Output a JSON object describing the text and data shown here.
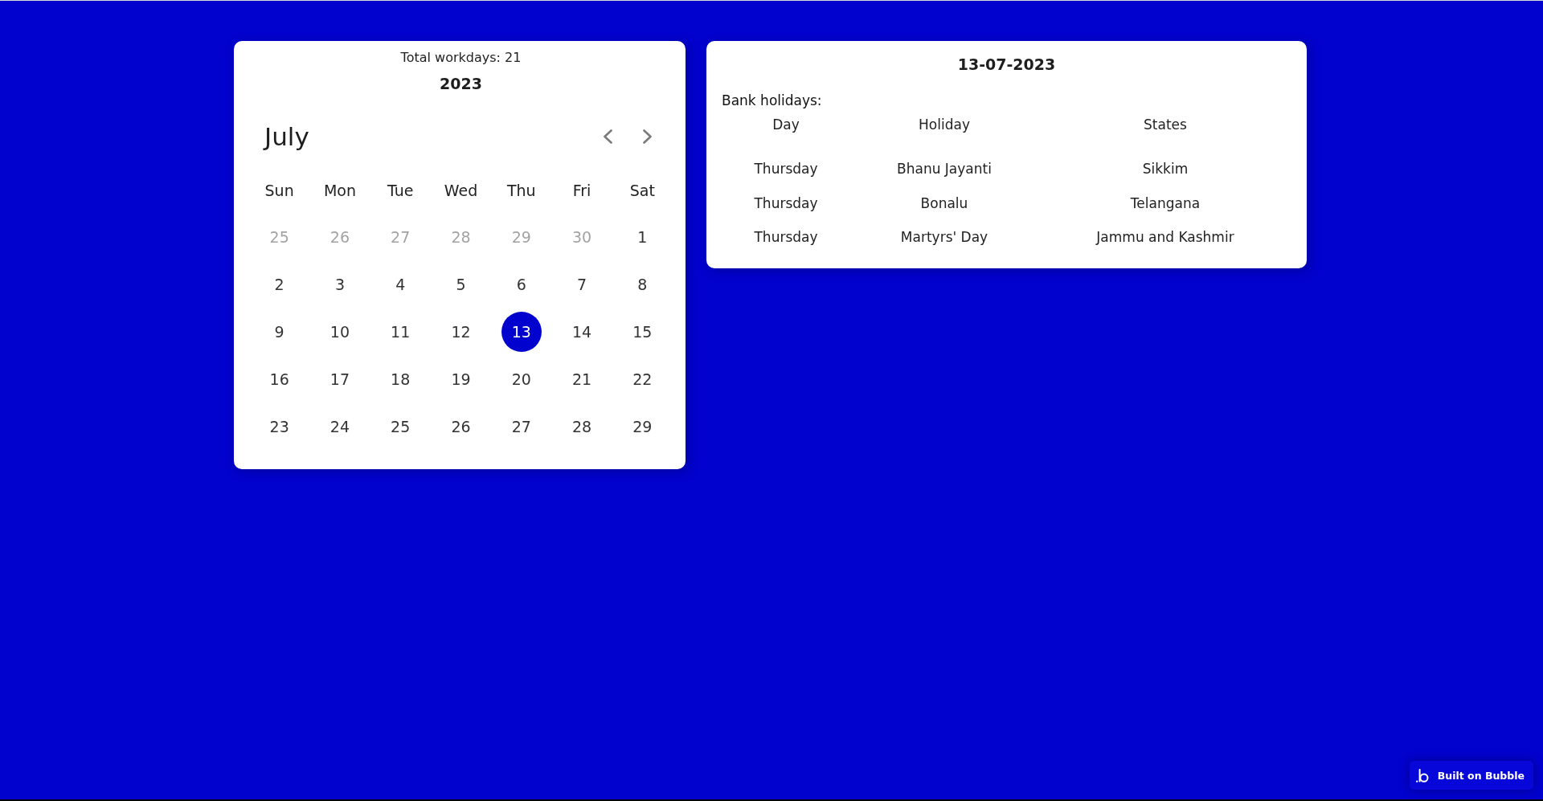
{
  "calendar": {
    "summary": "Total workdays: 21",
    "year": "2023",
    "month": "July",
    "weekdays": [
      "Sun",
      "Mon",
      "Tue",
      "Wed",
      "Thu",
      "Fri",
      "Sat"
    ],
    "days": [
      {
        "label": "25",
        "outside_month": true,
        "selected": false
      },
      {
        "label": "26",
        "outside_month": true,
        "selected": false
      },
      {
        "label": "27",
        "outside_month": true,
        "selected": false
      },
      {
        "label": "28",
        "outside_month": true,
        "selected": false
      },
      {
        "label": "29",
        "outside_month": true,
        "selected": false
      },
      {
        "label": "30",
        "outside_month": true,
        "selected": false
      },
      {
        "label": "1",
        "outside_month": false,
        "selected": false
      },
      {
        "label": "2",
        "outside_month": false,
        "selected": false
      },
      {
        "label": "3",
        "outside_month": false,
        "selected": false
      },
      {
        "label": "4",
        "outside_month": false,
        "selected": false
      },
      {
        "label": "5",
        "outside_month": false,
        "selected": false
      },
      {
        "label": "6",
        "outside_month": false,
        "selected": false
      },
      {
        "label": "7",
        "outside_month": false,
        "selected": false
      },
      {
        "label": "8",
        "outside_month": false,
        "selected": false
      },
      {
        "label": "9",
        "outside_month": false,
        "selected": false
      },
      {
        "label": "10",
        "outside_month": false,
        "selected": false
      },
      {
        "label": "11",
        "outside_month": false,
        "selected": false
      },
      {
        "label": "12",
        "outside_month": false,
        "selected": false
      },
      {
        "label": "13",
        "outside_month": false,
        "selected": true
      },
      {
        "label": "14",
        "outside_month": false,
        "selected": false
      },
      {
        "label": "15",
        "outside_month": false,
        "selected": false
      },
      {
        "label": "16",
        "outside_month": false,
        "selected": false
      },
      {
        "label": "17",
        "outside_month": false,
        "selected": false
      },
      {
        "label": "18",
        "outside_month": false,
        "selected": false
      },
      {
        "label": "19",
        "outside_month": false,
        "selected": false
      },
      {
        "label": "20",
        "outside_month": false,
        "selected": false
      },
      {
        "label": "21",
        "outside_month": false,
        "selected": false
      },
      {
        "label": "22",
        "outside_month": false,
        "selected": false
      },
      {
        "label": "23",
        "outside_month": false,
        "selected": false
      },
      {
        "label": "24",
        "outside_month": false,
        "selected": false
      },
      {
        "label": "25",
        "outside_month": false,
        "selected": false
      },
      {
        "label": "26",
        "outside_month": false,
        "selected": false
      },
      {
        "label": "27",
        "outside_month": false,
        "selected": false
      },
      {
        "label": "28",
        "outside_month": false,
        "selected": false
      },
      {
        "label": "29",
        "outside_month": false,
        "selected": false
      }
    ]
  },
  "day_details": {
    "date": "13-07-2023",
    "heading": "Bank holidays:",
    "columns": [
      "Day",
      "Holiday",
      "States"
    ],
    "rows": [
      {
        "day": "Thursday",
        "holiday": "Bhanu Jayanti",
        "states": "Sikkim"
      },
      {
        "day": "Thursday",
        "holiday": "Bonalu",
        "states": "Telangana"
      },
      {
        "day": "Thursday",
        "holiday": "Martyrs' Day",
        "states": "Jammu and Kashmir"
      }
    ]
  },
  "badge": {
    "label": "Built on Bubble"
  }
}
